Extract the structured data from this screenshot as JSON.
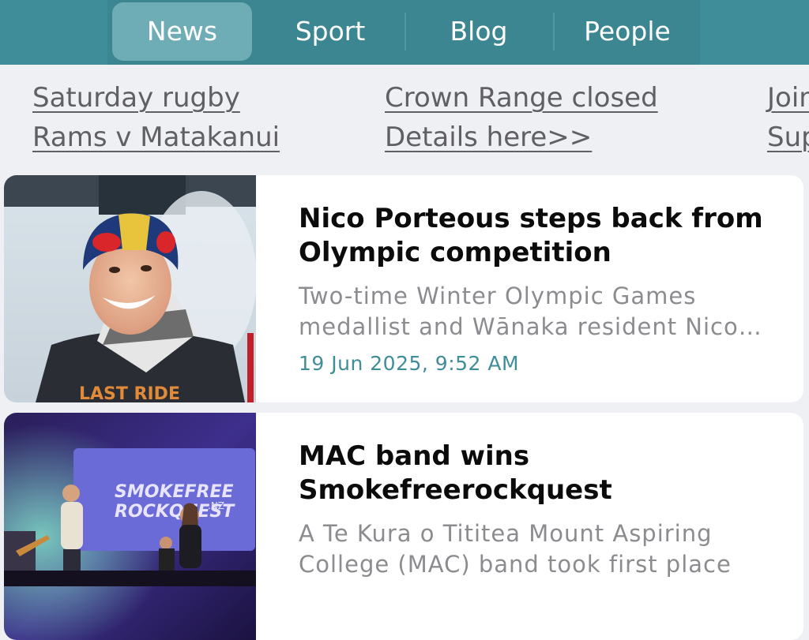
{
  "nav": {
    "tabs": [
      {
        "label": "News",
        "active": true
      },
      {
        "label": "Sport",
        "active": false
      },
      {
        "label": "Blog",
        "active": false
      },
      {
        "label": "People",
        "active": false
      }
    ],
    "colors": {
      "bar": "#3f8d98",
      "active_tab": "#6eadb5"
    }
  },
  "quick_links": [
    {
      "line1": "Saturday rugby",
      "line2": "Rams v Matakanui"
    },
    {
      "line1": "Crown Range closed",
      "line2": "Details here>>"
    },
    {
      "line1": "Join",
      "line2": "Sup"
    }
  ],
  "articles": [
    {
      "title_line1": "Nico Porteous steps back from",
      "title_line2": "Olympic competition",
      "summary_line1": "Two-time Winter Olympic Games",
      "summary_line2": "medallist and Wānaka resident Nico…",
      "date": "19 Jun 2025, 9:52 AM",
      "image": {
        "helmet_text": "Red Bull",
        "shirt_text": "LAST RIDE"
      }
    },
    {
      "title_line1": "MAC band wins",
      "title_line2": "Smokefreerockquest",
      "summary_line1": "A Te Kura o Tititea Mount Aspiring",
      "summary_line2": "College (MAC) band took first place",
      "date": "",
      "image": {
        "banner_line1": "SMOKEFREE",
        "banner_line2": "ROCKQUEST",
        "banner_suffix": ".NZ"
      }
    }
  ]
}
